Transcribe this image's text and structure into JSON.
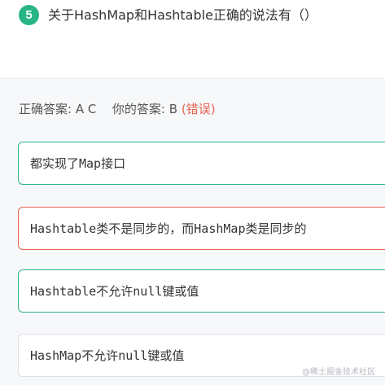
{
  "question": {
    "number": "5",
    "text": "关于HashMap和Hashtable正确的说法有（）"
  },
  "summary": {
    "correct_label": "正确答案:",
    "correct_value": "A C",
    "your_label": "你的答案:",
    "your_value": "B",
    "result": "(错误)"
  },
  "options": [
    {
      "text": "都实现了Map接口",
      "state": "correct"
    },
    {
      "text": "Hashtable类不是同步的，而HashMap类是同步的",
      "state": "wrong-selected"
    },
    {
      "text": "Hashtable不允许null键或值",
      "state": "correct"
    },
    {
      "text": "HashMap不允许null键或值",
      "state": "neutral"
    }
  ],
  "watermark": "@稀土掘金技术社区",
  "colors": {
    "accent_green": "#27b588",
    "error_red": "#e6644f",
    "answer_bg": "#f7f8fa"
  }
}
